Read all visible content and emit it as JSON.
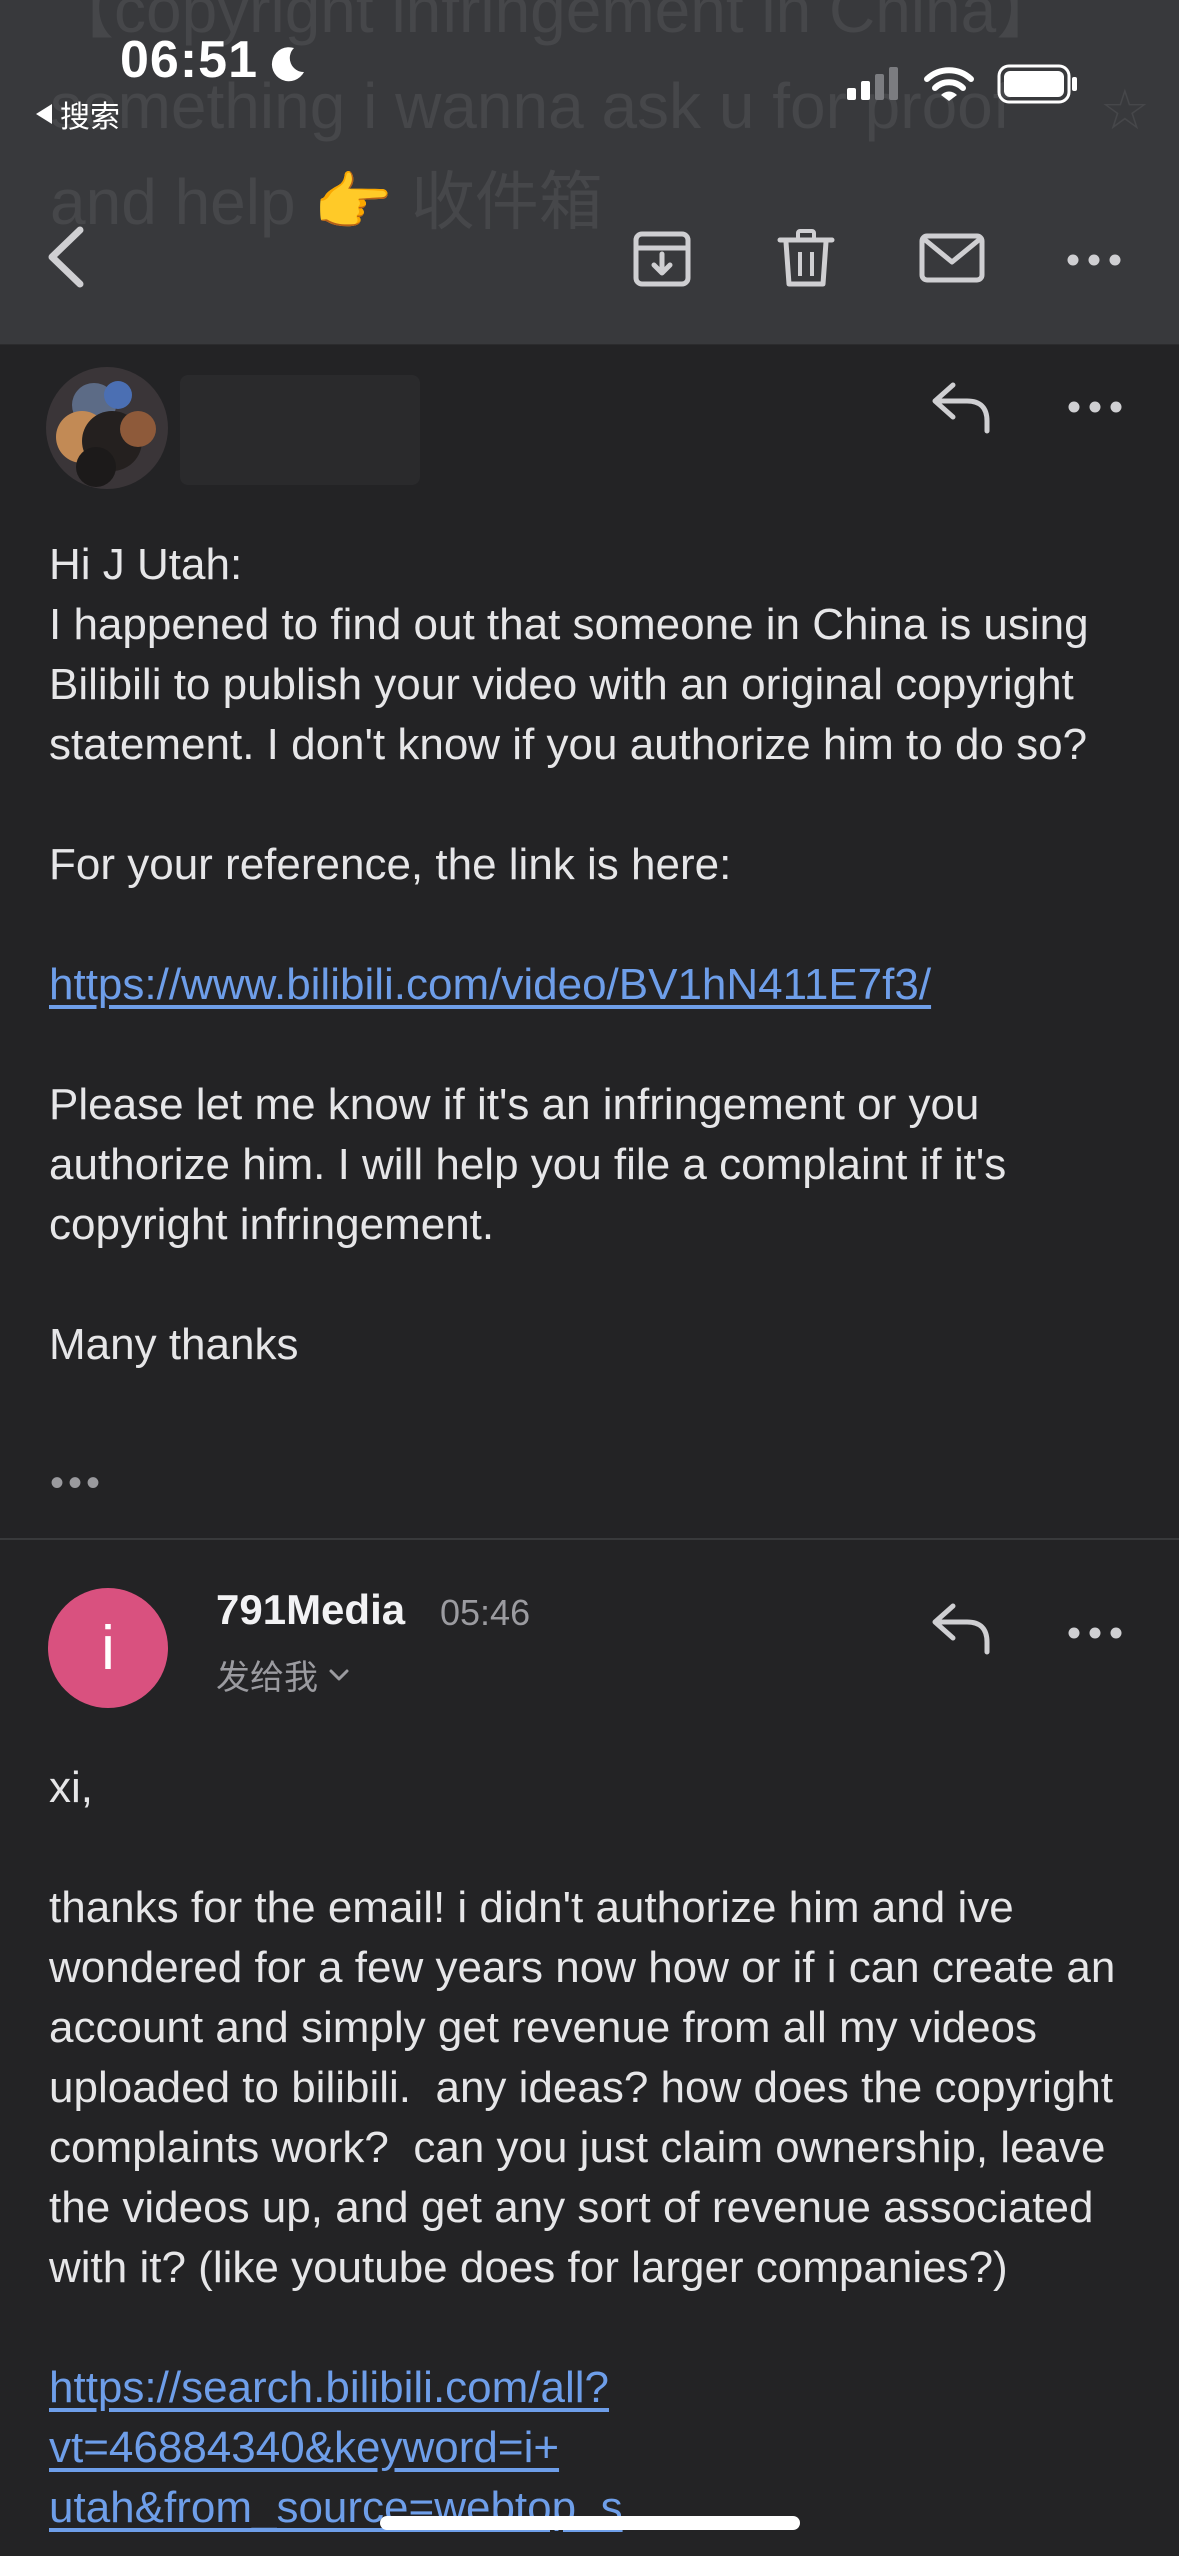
{
  "status_bar": {
    "time": "06:51",
    "back_label": "搜索"
  },
  "subject": {
    "text": "【copyright infringement in China】 something i wanna ask u for proof and help 👉 收件箱"
  },
  "toolbar": {
    "icons": [
      "chevron-left-icon",
      "archive-icon",
      "trash-icon",
      "mail-icon",
      "more-icon"
    ]
  },
  "messages": [
    {
      "body": {
        "greeting": "Hi J Utah:",
        "p1": "I happened to find out that someone in China is using Bilibili to publish your video with an original copyright statement. I don't know if you authorize him to do so?",
        "p2": "For your reference, the link is here:",
        "link": "https://www.bilibili.com/video/BV1hN411E7f3/",
        "p3": "Please let me know if it's an infringement or you authorize him. I will help you file a complaint if it's copyright infringement.",
        "closing": "Many thanks",
        "collapsed": "•••"
      }
    },
    {
      "avatar_letter": "i",
      "sender": "791Media",
      "time": "05:46",
      "recipient": "发给我",
      "body": {
        "greeting": "xi,",
        "p1": "thanks for the email! i didn't authorize him and ive wondered for a few years now how or if i can create an account and simply get revenue from all my videos uploaded to bilibili.  any ideas? how does the copyright complaints work?  can you just claim ownership, leave the videos up, and get any sort of revenue associated with it? (like youtube does for larger companies?)",
        "link_line1": "https://search.bilibili.com/all?",
        "link_line2": "vt=46884340&keyword=i+",
        "link_line3": "utah&from_source=webtop_s"
      }
    }
  ],
  "colors": {
    "background": "#232325",
    "header": "#38393c",
    "link": "#6e9ee9",
    "avatar": "#d9517f"
  }
}
